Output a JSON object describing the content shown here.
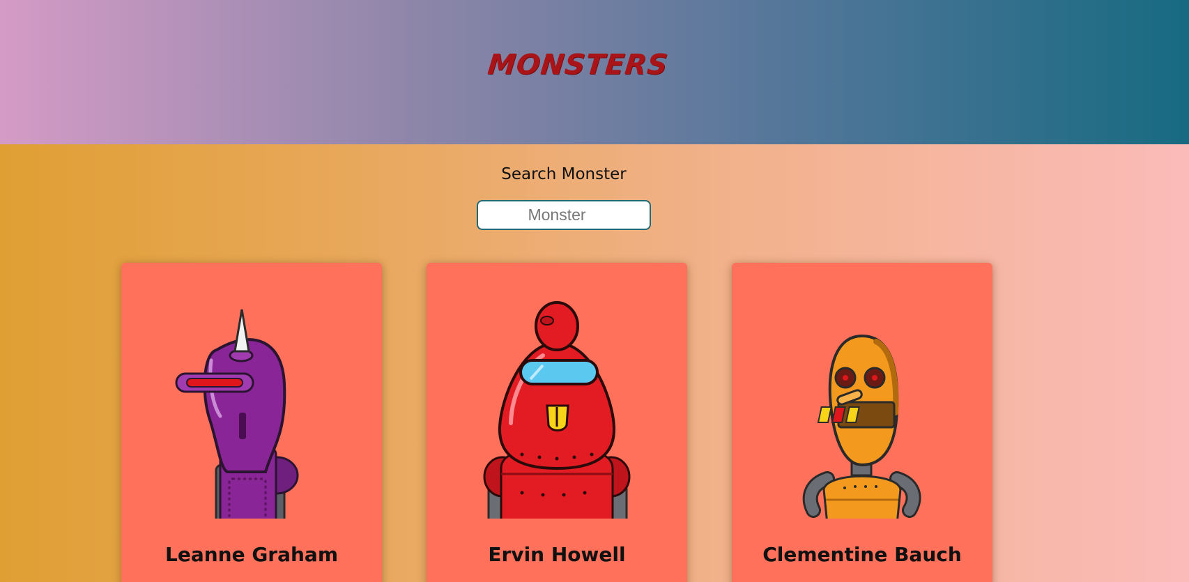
{
  "header": {
    "title": "Monsters"
  },
  "search": {
    "label": "Search Monster",
    "placeholder": "Monster"
  },
  "monsters": [
    {
      "name": "Leanne Graham",
      "icon": "purple-robot-icon"
    },
    {
      "name": "Ervin Howell",
      "icon": "red-robot-icon"
    },
    {
      "name": "Clementine Bauch",
      "icon": "orange-robot-icon"
    }
  ],
  "colors": {
    "header_gradient": [
      "#d49bc6",
      "#176a82"
    ],
    "body_gradient": [
      "#e09f33",
      "#fbbbb9"
    ],
    "card": "#ff715b",
    "title": "#a81418"
  }
}
